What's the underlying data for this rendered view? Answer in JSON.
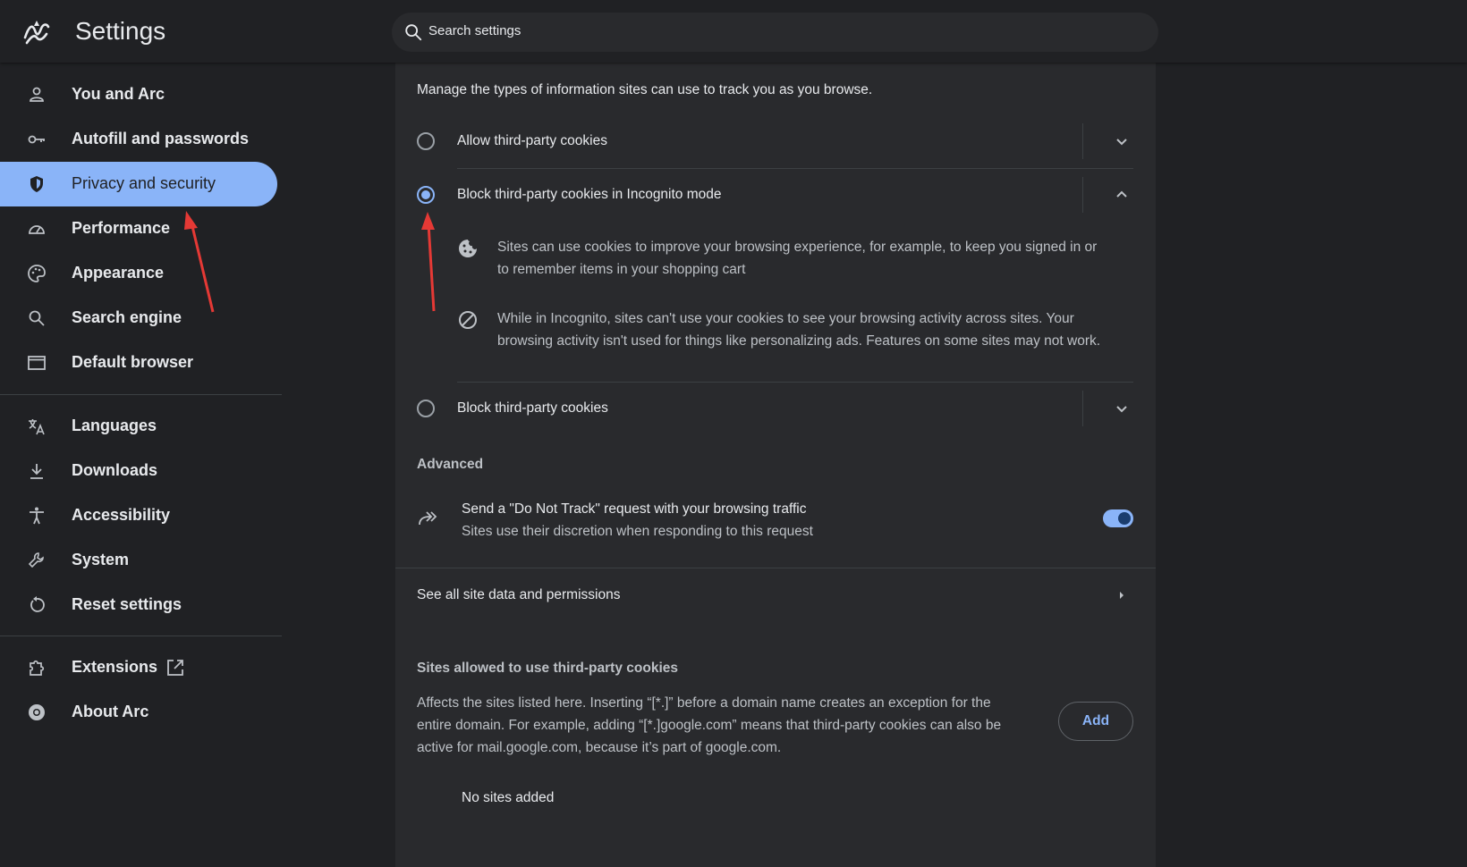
{
  "header": {
    "title": "Settings",
    "search_placeholder": "Search settings"
  },
  "sidebar": {
    "items": [
      {
        "label": "You and Arc",
        "icon": "person-icon"
      },
      {
        "label": "Autofill and passwords",
        "icon": "key-icon"
      },
      {
        "label": "Privacy and security",
        "icon": "shield-icon",
        "active": true
      },
      {
        "label": "Performance",
        "icon": "speedometer-icon"
      },
      {
        "label": "Appearance",
        "icon": "palette-icon"
      },
      {
        "label": "Search engine",
        "icon": "search-icon"
      },
      {
        "label": "Default browser",
        "icon": "browser-window-icon"
      },
      {
        "label": "Languages",
        "icon": "translate-icon"
      },
      {
        "label": "Downloads",
        "icon": "download-icon"
      },
      {
        "label": "Accessibility",
        "icon": "accessibility-icon"
      },
      {
        "label": "System",
        "icon": "wrench-icon"
      },
      {
        "label": "Reset settings",
        "icon": "reset-icon"
      },
      {
        "label": "Extensions",
        "icon": "puzzle-icon"
      },
      {
        "label": "About Arc",
        "icon": "arc-logo-icon"
      }
    ]
  },
  "main": {
    "intro": "Manage the types of information sites can use to track you as you browse.",
    "options": [
      {
        "label": "Allow third-party cookies",
        "selected": false
      },
      {
        "label": "Block third-party cookies in Incognito mode",
        "selected": true
      },
      {
        "label": "Block third-party cookies",
        "selected": false
      }
    ],
    "details": [
      {
        "line1": "Sites can use cookies to improve your browsing experience, for example, to keep you signed in or",
        "line2": "to remember items in your shopping cart"
      },
      {
        "line1": "While in Incognito, sites can't use your cookies to see your browsing activity across sites. Your",
        "line2": "browsing activity isn't used for things like personalizing ads. Features on some sites may not work."
      }
    ],
    "advanced_heading": "Advanced",
    "dnt": {
      "title": "Send a \"Do Not Track\" request with your browsing traffic",
      "subtitle": "Sites use their discretion when responding to this request",
      "enabled": true
    },
    "site_data_link": "See all site data and permissions",
    "allowed": {
      "heading": "Sites allowed to use third-party cookies",
      "desc_line1": "Affects the sites listed here. Inserting “[*.]” before a domain name creates an exception for the",
      "desc_line2": "entire domain. For example, adding “[*.]google.com” means that third-party cookies can also be",
      "desc_line3": "active for mail.google.com, because it’s part of google.com.",
      "add_label": "Add",
      "empty": "No sites added"
    }
  },
  "colors": {
    "accent": "#8ab4f8",
    "background": "#202124",
    "card": "#292a2d",
    "annotation_arrow": "#e53935"
  }
}
